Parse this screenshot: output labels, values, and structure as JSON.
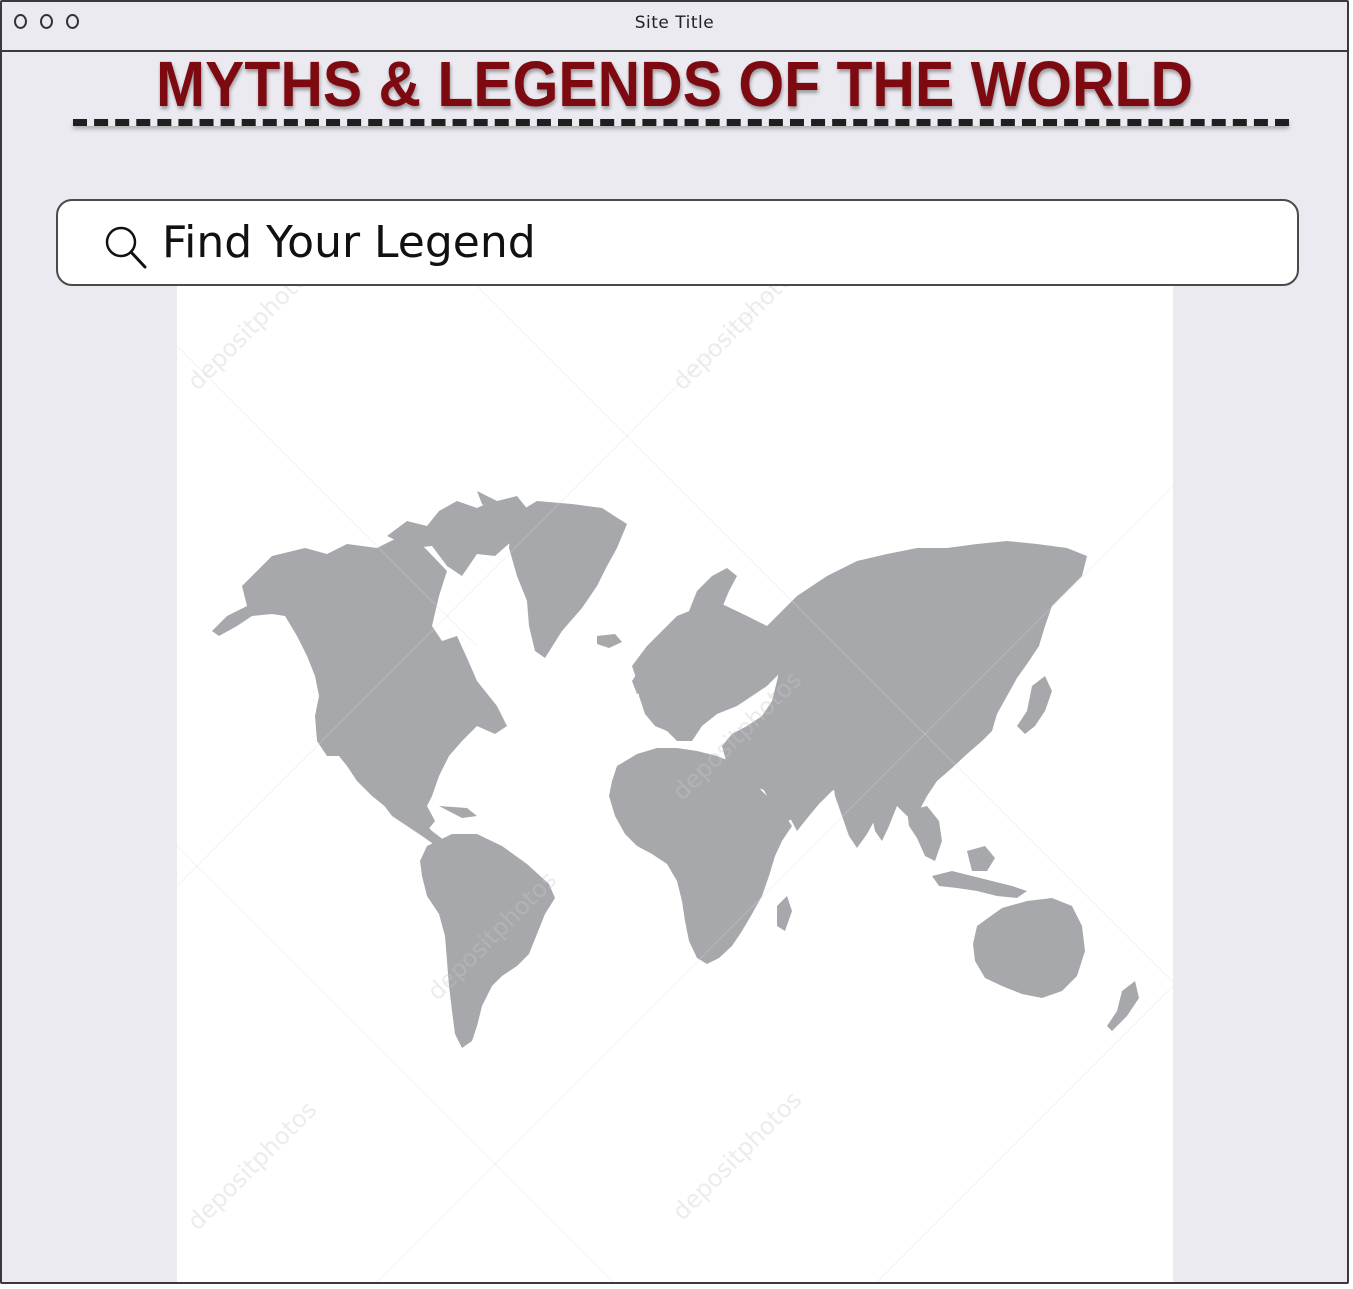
{
  "window": {
    "title": "Site Title"
  },
  "page": {
    "headline": "MYTHS & LEGENDS OF THE WORLD"
  },
  "search": {
    "placeholder": "Find Your Legend",
    "icon": "search-icon"
  },
  "map": {
    "land_color": "#a7a8ab",
    "watermark_text": "depositphotos"
  }
}
